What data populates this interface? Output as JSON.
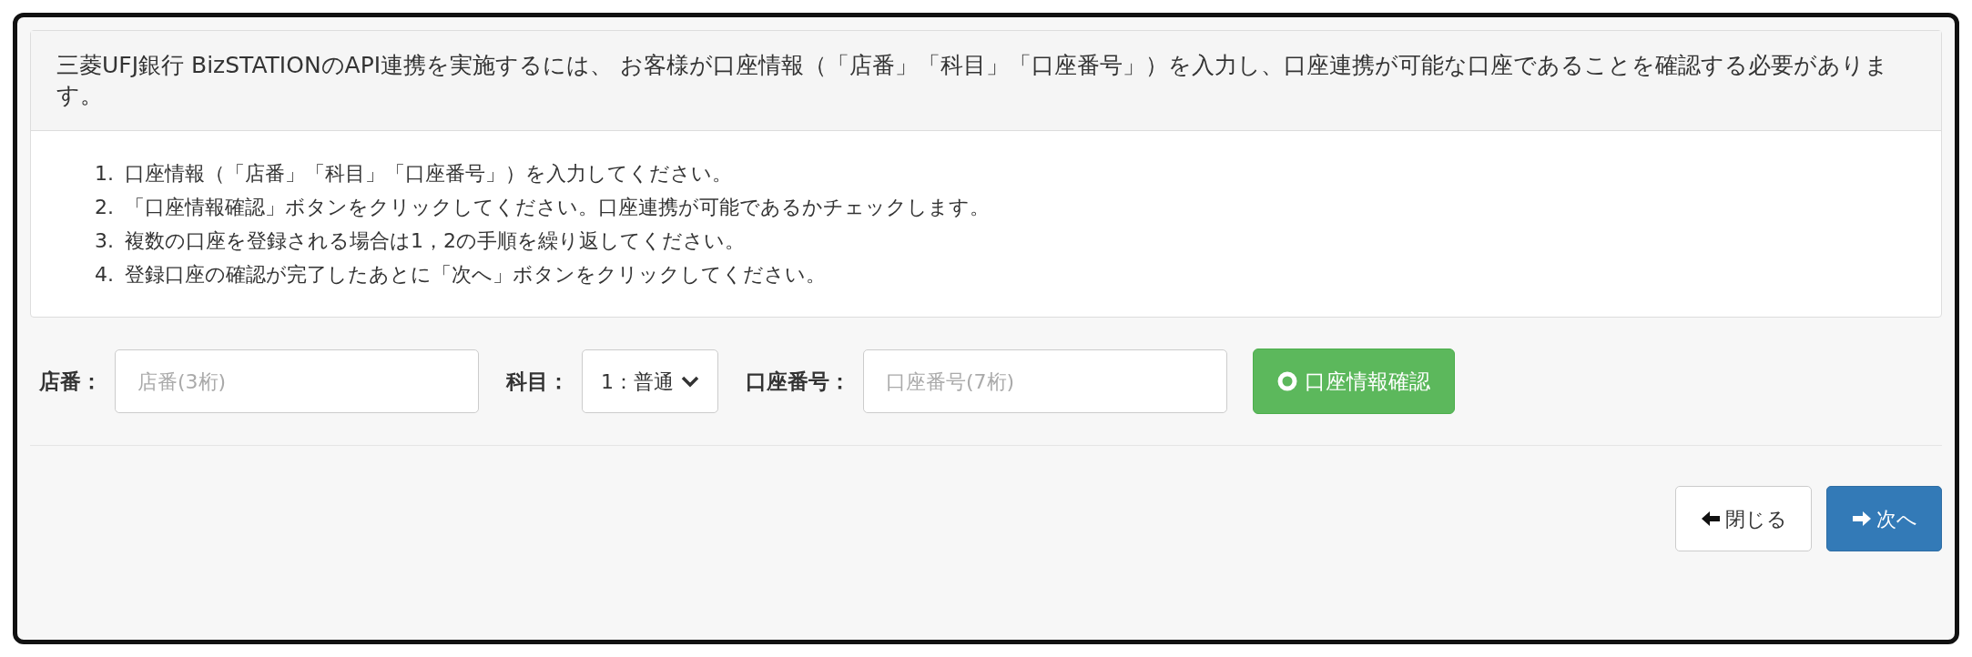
{
  "panel": {
    "heading": "三菱UFJ銀行 BizSTATIONのAPI連携を実施するには、 お客様が口座情報（「店番」「科目」「口座番号」）を入力し、口座連携が可能な口座であることを確認する必要があります。",
    "steps": [
      {
        "number": "1.",
        "text": "口座情報（「店番」「科目」「口座番号」）を入力してください。"
      },
      {
        "number": "2.",
        "text": "「口座情報確認」ボタンをクリックしてください。口座連携が可能であるかチェックします。"
      },
      {
        "number": "3.",
        "text": "複数の口座を登録される場合は1，2の手順を繰り返してください。"
      },
      {
        "number": "4.",
        "text": "登録口座の確認が完了したあとに「次へ」ボタンをクリックしてください。"
      }
    ]
  },
  "form": {
    "branch": {
      "label": "店番：",
      "placeholder": "店番(3桁)"
    },
    "subject": {
      "label": "科目：",
      "value": "1：普通"
    },
    "account": {
      "label": "口座番号：",
      "placeholder": "口座番号(7桁)"
    },
    "check_button": "口座情報確認"
  },
  "footer": {
    "buttons": [
      {
        "kind": "back",
        "label": "閉じる"
      },
      {
        "kind": "next",
        "label": "次へ"
      }
    ]
  }
}
